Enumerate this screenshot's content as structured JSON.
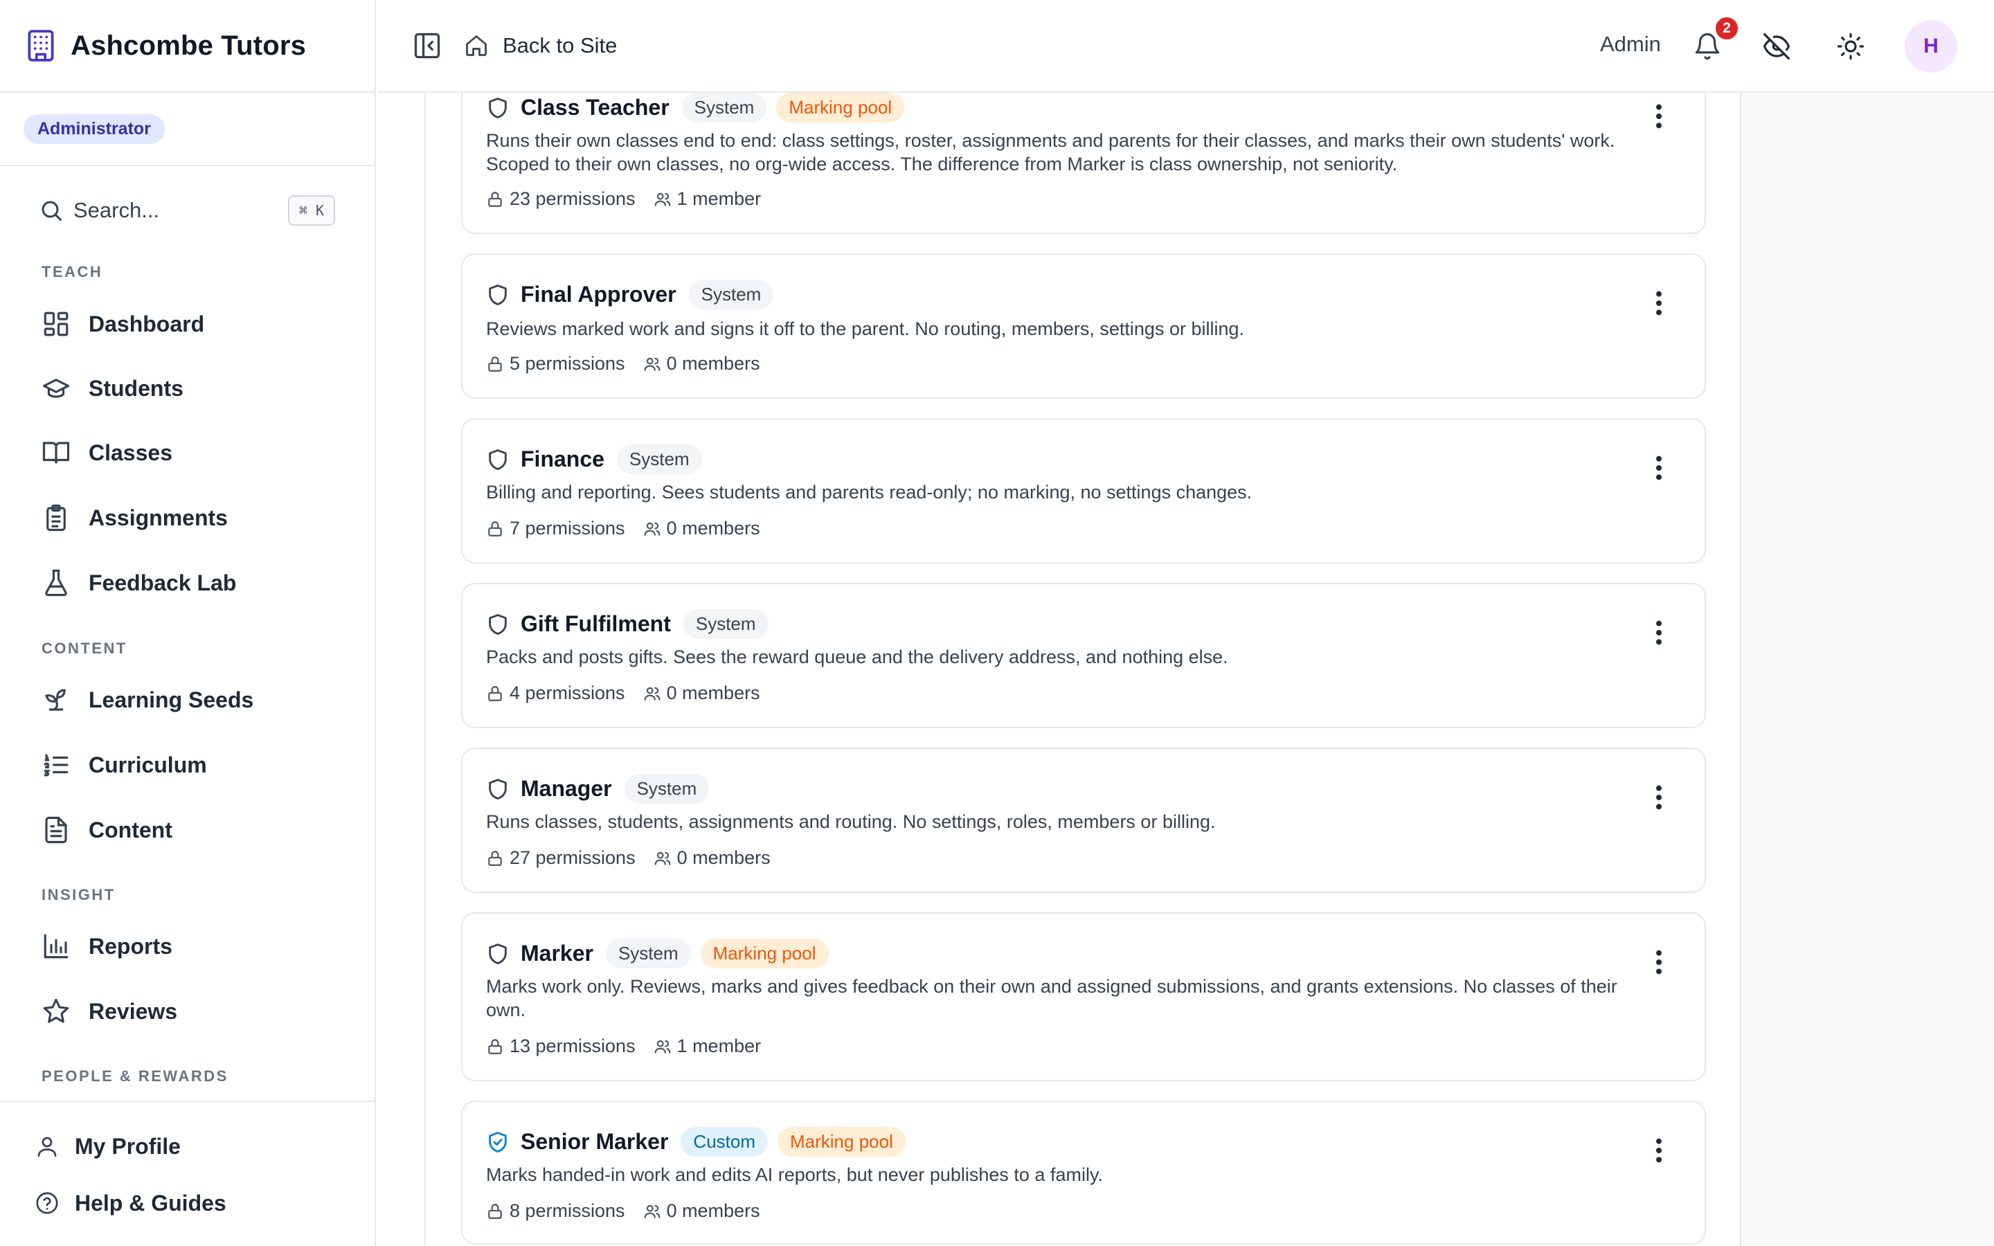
{
  "app": {
    "title": "Ashcombe Tutors",
    "role_badge": "Administrator"
  },
  "search": {
    "placeholder": "Search...",
    "shortcut": "⌘ K"
  },
  "sidebar": {
    "sections": [
      {
        "label": "TEACH",
        "items": [
          {
            "label": "Dashboard",
            "icon": "dashboard-icon"
          },
          {
            "label": "Students",
            "icon": "graduation-cap-icon"
          },
          {
            "label": "Classes",
            "icon": "book-open-icon"
          },
          {
            "label": "Assignments",
            "icon": "clipboard-icon"
          },
          {
            "label": "Feedback Lab",
            "icon": "flask-icon"
          }
        ]
      },
      {
        "label": "CONTENT",
        "items": [
          {
            "label": "Learning Seeds",
            "icon": "sprout-icon"
          },
          {
            "label": "Curriculum",
            "icon": "list-ordered-icon"
          },
          {
            "label": "Content",
            "icon": "file-text-icon"
          }
        ]
      },
      {
        "label": "INSIGHT",
        "items": [
          {
            "label": "Reports",
            "icon": "bar-chart-icon"
          },
          {
            "label": "Reviews",
            "icon": "star-icon"
          }
        ]
      },
      {
        "label": "PEOPLE & REWARDS",
        "items": []
      }
    ],
    "footer": [
      {
        "label": "My Profile",
        "icon": "user-icon"
      },
      {
        "label": "Help & Guides",
        "icon": "help-circle-icon"
      }
    ]
  },
  "topbar": {
    "back_label": "Back to Site",
    "user_label": "Admin",
    "notification_count": "2",
    "avatar_initial": "H"
  },
  "roles": [
    {
      "title": "Class Teacher",
      "tags": [
        "System",
        "Marking pool"
      ],
      "type": "system",
      "description": "Runs their own classes end to end: class settings, roster, assignments and parents for their classes, and marks their own students' work. Scoped to their own classes, no org-wide access. The difference from Marker is class ownership, not seniority.",
      "permissions": "23 permissions",
      "members": "1 member"
    },
    {
      "title": "Final Approver",
      "tags": [
        "System"
      ],
      "type": "system",
      "description": "Reviews marked work and signs it off to the parent. No routing, members, settings or billing.",
      "permissions": "5 permissions",
      "members": "0 members"
    },
    {
      "title": "Finance",
      "tags": [
        "System"
      ],
      "type": "system",
      "description": "Billing and reporting. Sees students and parents read-only; no marking, no settings changes.",
      "permissions": "7 permissions",
      "members": "0 members"
    },
    {
      "title": "Gift Fulfilment",
      "tags": [
        "System"
      ],
      "type": "system",
      "description": "Packs and posts gifts. Sees the reward queue and the delivery address, and nothing else.",
      "permissions": "4 permissions",
      "members": "0 members"
    },
    {
      "title": "Manager",
      "tags": [
        "System"
      ],
      "type": "system",
      "description": "Runs classes, students, assignments and routing. No settings, roles, members or billing.",
      "permissions": "27 permissions",
      "members": "0 members"
    },
    {
      "title": "Marker",
      "tags": [
        "System",
        "Marking pool"
      ],
      "type": "system",
      "description": "Marks work only. Reviews, marks and gives feedback on their own and assigned submissions, and grants extensions. No classes of their own.",
      "permissions": "13 permissions",
      "members": "1 member"
    },
    {
      "title": "Senior Marker",
      "tags": [
        "Custom",
        "Marking pool"
      ],
      "type": "custom",
      "description": "Marks handed-in work and edits AI reports, but never publishes to a family.",
      "permissions": "8 permissions",
      "members": "0 members"
    }
  ],
  "colors": {
    "brand": "#4338ca",
    "system_tag_bg": "#f3f4f6",
    "custom_tag_bg": "#e0f2fe",
    "marking_pool_bg": "#ffedd5",
    "marking_pool_text": "#ea580c",
    "notification_badge": "#dc2626"
  }
}
